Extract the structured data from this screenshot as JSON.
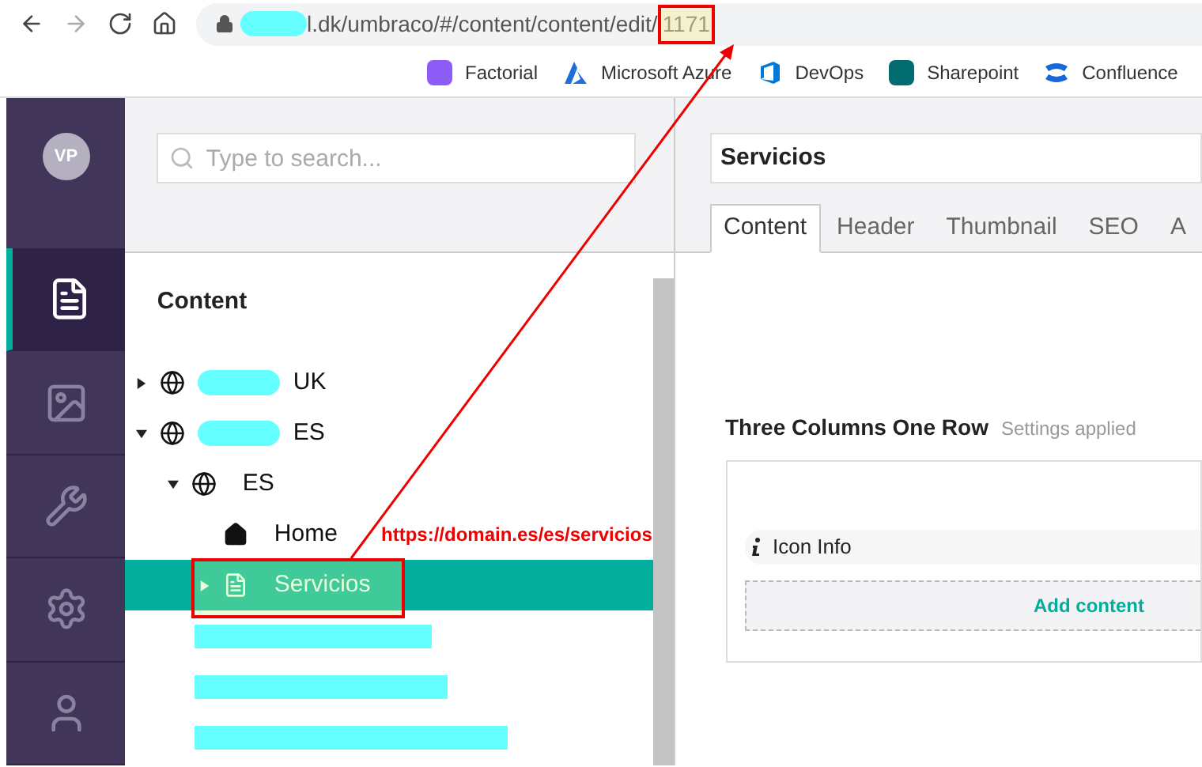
{
  "browser": {
    "url_visible": "l.dk/umbraco/#/content/content/edit/",
    "url_highlight": "1171",
    "bookmarks": [
      {
        "label": "Factorial",
        "kind": "factorial"
      },
      {
        "label": "Microsoft Azure",
        "kind": "azure"
      },
      {
        "label": "DevOps",
        "kind": "devops"
      },
      {
        "label": "Sharepoint",
        "kind": "sharepoint"
      },
      {
        "label": "Confluence",
        "kind": "confluence"
      }
    ]
  },
  "sidebar": {
    "avatar": "VP",
    "items": [
      {
        "kind": "content",
        "selected": true
      },
      {
        "kind": "media",
        "selected": false
      },
      {
        "kind": "settings",
        "selected": false
      },
      {
        "kind": "gear",
        "selected": false
      },
      {
        "kind": "user",
        "selected": false
      }
    ]
  },
  "tree": {
    "search_placeholder": "Type to search...",
    "heading": "Content",
    "nodes": [
      {
        "label": "UK",
        "kind": "globe",
        "redacted": true,
        "expanded": false,
        "has_children": true,
        "selected": false
      },
      {
        "label": "ES",
        "kind": "globe",
        "redacted": true,
        "expanded": true,
        "has_children": true,
        "selected": false,
        "children": [
          {
            "label": "ES",
            "kind": "globe",
            "redacted": false,
            "expanded": true,
            "has_children": true,
            "selected": false,
            "children": [
              {
                "label": "Home",
                "kind": "home",
                "redacted": false,
                "has_children": false,
                "selected": false
              },
              {
                "label": "Servicios",
                "kind": "page",
                "redacted": false,
                "expanded": false,
                "has_children": true,
                "selected": true
              }
            ]
          }
        ]
      }
    ]
  },
  "annotation": {
    "url_text": "https://domain.es/es/servicios"
  },
  "editor": {
    "name": "Servicios",
    "tabs": [
      {
        "label": "Content",
        "selected": true
      },
      {
        "label": "Header",
        "selected": false
      },
      {
        "label": "Thumbnail",
        "selected": false
      },
      {
        "label": "SEO",
        "selected": false
      },
      {
        "label": "A",
        "selected": false
      }
    ],
    "section_title": "Three Columns One Row",
    "section_note": "Settings applied",
    "block_label": "Icon Info",
    "add_button": "Add content"
  }
}
